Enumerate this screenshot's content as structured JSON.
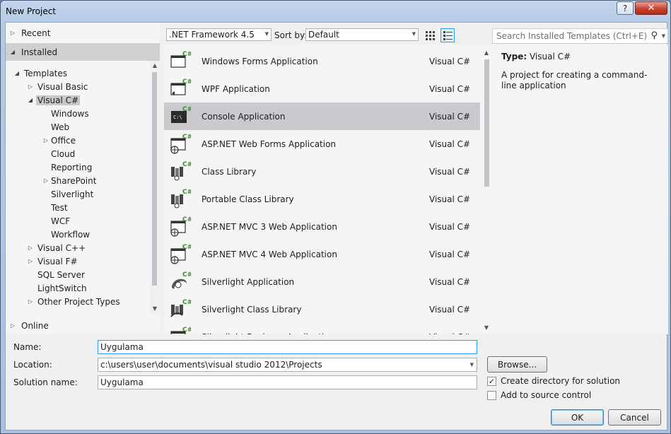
{
  "window": {
    "title": "New Project",
    "help_label": "?",
    "close_label": "✕"
  },
  "nav": {
    "recent": "Recent",
    "installed": "Installed",
    "templates": "Templates",
    "visual_basic": "Visual Basic",
    "visual_csharp": "Visual C#",
    "csharp_children": [
      "Windows",
      "Web",
      "Office",
      "Cloud",
      "Reporting",
      "SharePoint",
      "Silverlight",
      "Test",
      "WCF",
      "Workflow"
    ],
    "visual_cpp": "Visual C++",
    "visual_fsharp": "Visual F#",
    "sql_server": "SQL Server",
    "lightswitch": "LightSwitch",
    "other_types": "Other Project Types",
    "online": "Online"
  },
  "toolbar": {
    "framework": ".NET Framework 4.5",
    "sort_label": "Sort by:",
    "sort_value": "Default",
    "search_placeholder": "Search Installed Templates (Ctrl+E)"
  },
  "templates": [
    {
      "name": "Windows Forms Application",
      "lang": "Visual C#",
      "icon": "windows-forms-icon"
    },
    {
      "name": "WPF Application",
      "lang": "Visual C#",
      "icon": "wpf-icon"
    },
    {
      "name": "Console Application",
      "lang": "Visual C#",
      "icon": "console-icon"
    },
    {
      "name": "ASP.NET Web Forms Application",
      "lang": "Visual C#",
      "icon": "web-forms-icon"
    },
    {
      "name": "Class Library",
      "lang": "Visual C#",
      "icon": "class-library-icon"
    },
    {
      "name": "Portable Class Library",
      "lang": "Visual C#",
      "icon": "portable-library-icon"
    },
    {
      "name": "ASP.NET MVC 3 Web Application",
      "lang": "Visual C#",
      "icon": "mvc3-icon"
    },
    {
      "name": "ASP.NET MVC 4 Web Application",
      "lang": "Visual C#",
      "icon": "mvc4-icon"
    },
    {
      "name": "Silverlight Application",
      "lang": "Visual C#",
      "icon": "silverlight-icon"
    },
    {
      "name": "Silverlight Class Library",
      "lang": "Visual C#",
      "icon": "silverlight-library-icon"
    },
    {
      "name": "Silverlight Business Application",
      "lang": "Visual C#",
      "icon": "silverlight-business-icon"
    }
  ],
  "selected_template": "Console Application",
  "description": {
    "type_label": "Type:",
    "type_value": "Visual C#",
    "text": "A project for creating a command-line application"
  },
  "form": {
    "name_label": "Name:",
    "name_value": "Uygulama",
    "location_label": "Location:",
    "location_value": "c:\\users\\user\\documents\\visual studio 2012\\Projects",
    "solution_label": "Solution name:",
    "solution_value": "Uygulama",
    "browse_label": "Browse...",
    "create_dir_label": "Create directory for solution",
    "create_dir_checked": true,
    "source_control_label": "Add to source control",
    "source_control_checked": false,
    "ok_label": "OK",
    "cancel_label": "Cancel"
  }
}
